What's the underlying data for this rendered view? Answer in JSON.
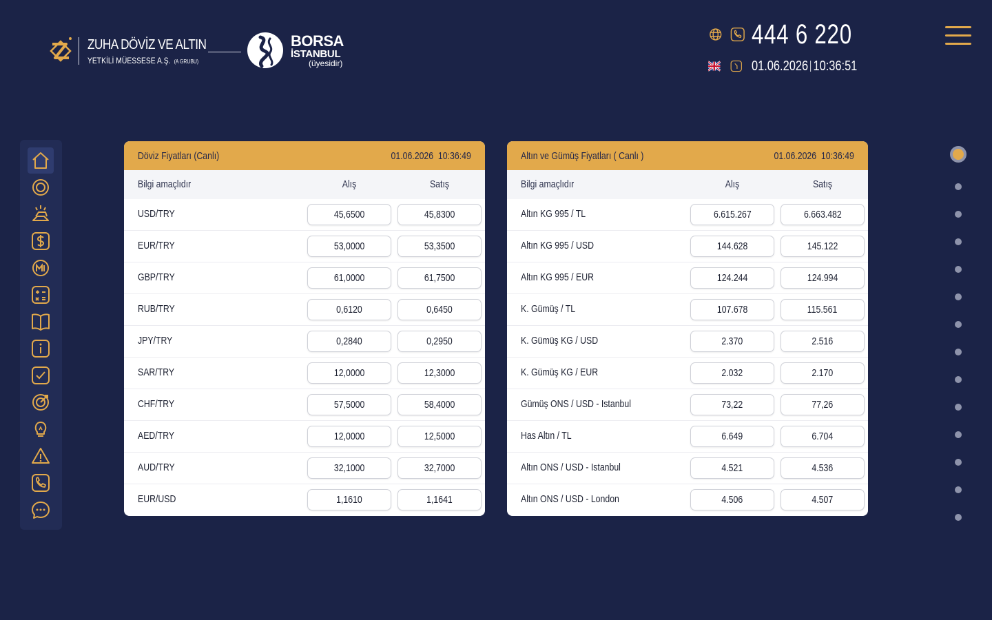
{
  "brand": {
    "name": "ZUHA DÖVİZ VE ALTIN",
    "subtitle": "YETKİLİ MÜESSESE A.Ş.",
    "group": "(A GRUBU)"
  },
  "borsa": {
    "line1": "BORSA",
    "line2": "İSTANBUL",
    "line3": "(üyesidir)"
  },
  "contact": {
    "phone": "444 6 220",
    "date": "01.06.2026",
    "time": "10:36:51"
  },
  "colors": {
    "background": "#1b2347",
    "accent": "#e2a94b",
    "sidebar": "#222c55",
    "panel": "#ffffff"
  },
  "sidebar": {
    "items": [
      {
        "icon": "home-icon"
      },
      {
        "icon": "gold-coin-icon"
      },
      {
        "icon": "gold-bars-icon"
      },
      {
        "icon": "dollar-icon"
      },
      {
        "icon": "central-bank-icon"
      },
      {
        "icon": "calculator-icon"
      },
      {
        "icon": "book-icon"
      },
      {
        "icon": "info-icon"
      },
      {
        "icon": "checkbox-icon"
      },
      {
        "icon": "target-icon"
      },
      {
        "icon": "lightbulb-icon"
      },
      {
        "icon": "warning-icon"
      },
      {
        "icon": "phone-icon"
      },
      {
        "icon": "chat-icon"
      }
    ]
  },
  "currency_panel": {
    "title": "Döviz Fiyatları (Canlı)",
    "date": "01.06.2026",
    "time": "10:36:49",
    "col_name": "Bilgi amaçlıdır",
    "col_buy": "Alış",
    "col_sell": "Satış",
    "rows": [
      {
        "name": "USD/TRY",
        "buy": "45,6500",
        "sell": "45,8300"
      },
      {
        "name": "EUR/TRY",
        "buy": "53,0000",
        "sell": "53,3500"
      },
      {
        "name": "GBP/TRY",
        "buy": "61,0000",
        "sell": "61,7500"
      },
      {
        "name": "RUB/TRY",
        "buy": "0,6120",
        "sell": "0,6450"
      },
      {
        "name": "JPY/TRY",
        "buy": "0,2840",
        "sell": "0,2950"
      },
      {
        "name": "SAR/TRY",
        "buy": "12,0000",
        "sell": "12,3000"
      },
      {
        "name": "CHF/TRY",
        "buy": "57,5000",
        "sell": "58,4000"
      },
      {
        "name": "AED/TRY",
        "buy": "12,0000",
        "sell": "12,5000"
      },
      {
        "name": "AUD/TRY",
        "buy": "32,1000",
        "sell": "32,7000"
      },
      {
        "name": "EUR/USD",
        "buy": "1,1610",
        "sell": "1,1641"
      }
    ]
  },
  "metals_panel": {
    "title": "Altın ve Gümüş Fiyatları ( Canlı )",
    "date": "01.06.2026",
    "time": "10:36:49",
    "col_name": "Bilgi amaçlıdır",
    "col_buy": "Alış",
    "col_sell": "Satış",
    "rows": [
      {
        "name": "Altın KG 995 / TL",
        "buy": "6.615.267",
        "sell": "6.663.482"
      },
      {
        "name": "Altın KG 995 / USD",
        "buy": "144.628",
        "sell": "145.122"
      },
      {
        "name": "Altın KG 995 / EUR",
        "buy": "124.244",
        "sell": "124.994"
      },
      {
        "name": "K. Gümüş / TL",
        "buy": "107.678",
        "sell": "115.561"
      },
      {
        "name": "K. Gümüş KG / USD",
        "buy": "2.370",
        "sell": "2.516"
      },
      {
        "name": "K. Gümüş KG / EUR",
        "buy": "2.032",
        "sell": "2.170"
      },
      {
        "name": "Gümüş ONS / USD - Istanbul",
        "buy": "73,22",
        "sell": "77,26"
      },
      {
        "name": "Has Altın / TL",
        "buy": "6.649",
        "sell": "6.704"
      },
      {
        "name": "Altın ONS / USD - Istanbul",
        "buy": "4.521",
        "sell": "4.536"
      },
      {
        "name": "Altın ONS / USD - London",
        "buy": "4.506",
        "sell": "4.507"
      }
    ]
  },
  "page_nav": {
    "count": 14,
    "active_index": 0
  }
}
